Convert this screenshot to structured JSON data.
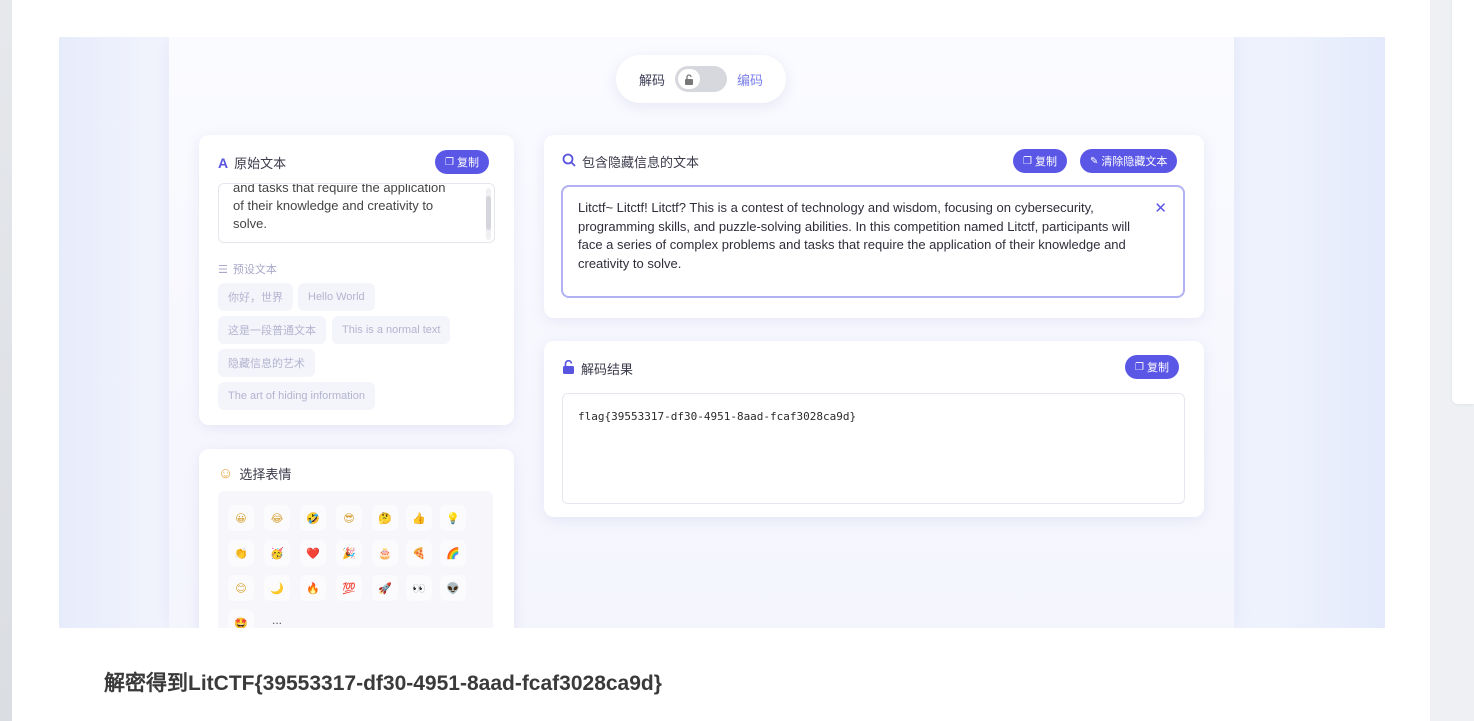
{
  "toggle": {
    "left_label": "解码",
    "right_label": "编码",
    "switch_icon": "lock-icon"
  },
  "original_card": {
    "title": "原始文本",
    "copy_label": "复制",
    "text_lines": [
      "and tasks that require the application",
      "of their knowledge and creativity to",
      "solve."
    ],
    "preset_label": "预设文本",
    "presets": [
      "你好，世界",
      "Hello World",
      "这是一段普通文本",
      "This is a normal text",
      "隐藏信息的艺术",
      "The art of hiding information"
    ]
  },
  "emoji_card": {
    "title": "选择表情",
    "emojis": [
      "😀",
      "😂",
      "🤣",
      "😎",
      "🤔",
      "👍",
      "💡",
      "👏",
      "🥳",
      "❤️",
      "🎉",
      "🎂",
      "🍕",
      "🌈",
      "😊",
      "🌙",
      "🔥",
      "💯",
      "🚀",
      "👀",
      "👽",
      "🤩"
    ],
    "more": "..."
  },
  "hidden_card": {
    "title": "包含隐藏信息的文本",
    "copy_label": "复制",
    "clear_label": "清除隐藏文本",
    "text": "Litctf~ Litctf! Litctf? This is a contest of technology and wisdom, focusing on cybersecurity, programming skills, and puzzle-solving abilities. In this competition named Litctf, participants will face a series of complex problems and tasks that require the application of their knowledge and creativity to solve."
  },
  "result_card": {
    "title": "解码结果",
    "copy_label": "复制",
    "result": "flag{39553317-df30-4951-8aad-fcaf3028ca9d}"
  },
  "caption": "解密得到LitCTF{39553317-df30-4951-8aad-fcaf3028ca9d}",
  "colors": {
    "accent": "#5b57e6",
    "border_focus": "#b2b2f2"
  }
}
